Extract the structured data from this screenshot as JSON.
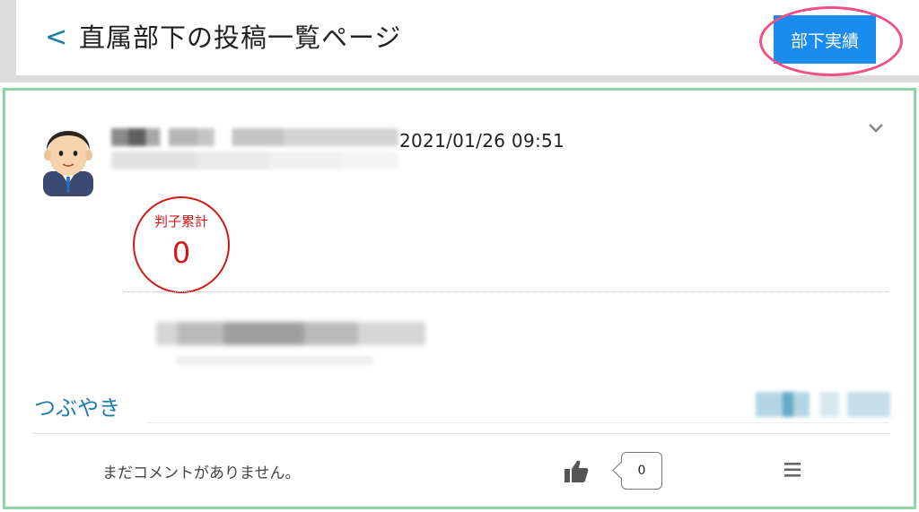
{
  "header": {
    "back_label": "<",
    "title": "直属部下の投稿一覧ページ",
    "performance_button": "部下実績"
  },
  "post": {
    "date": "2021/01/26 09:51",
    "stamp": {
      "label": "判子累計",
      "value": "0"
    },
    "tag": "つぶやき",
    "no_comment_text": "まだコメントがありません。",
    "comment_count": "0"
  },
  "icons": {
    "back": "back-chevron-icon",
    "collapse": "chevron-down-icon",
    "like": "thumbs-up-icon",
    "menu": "hamburger-menu-icon",
    "avatar": "user-avatar"
  },
  "colors": {
    "accent_blue": "#1a8cf0",
    "link_blue": "#1d7bb0",
    "stamp_red": "#d01818",
    "card_border": "#90d6a4",
    "highlight_pink": "#f0508a"
  }
}
